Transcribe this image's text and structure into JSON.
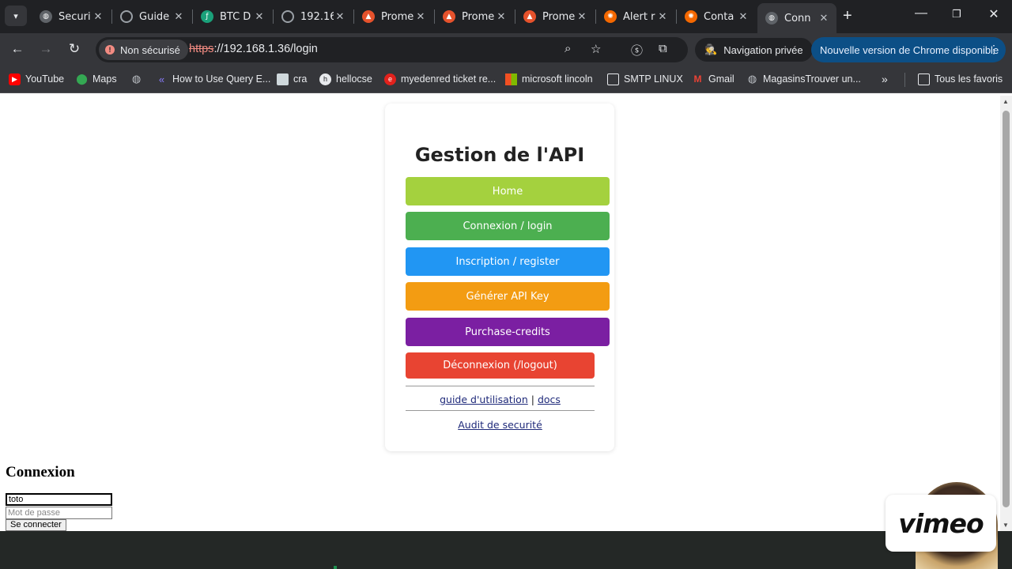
{
  "tabs": [
    {
      "label": "Securi",
      "favicon": "globe-icon",
      "color": "#9aa0a6"
    },
    {
      "label": "Guide",
      "favicon": "loading-icon",
      "color": "#9aa0a6"
    },
    {
      "label": "BTC D",
      "favicon": "feather-icon",
      "color": "#1aa17a"
    },
    {
      "label": "192.16",
      "favicon": "loading-icon",
      "color": "#9aa0a6"
    },
    {
      "label": "Prome",
      "favicon": "prometheus-icon",
      "color": "#e6522c"
    },
    {
      "label": "Prome",
      "favicon": "prometheus-icon",
      "color": "#e6522c"
    },
    {
      "label": "Prome",
      "favicon": "prometheus-icon",
      "color": "#e6522c"
    },
    {
      "label": "Alert r",
      "favicon": "grafana-icon",
      "color": "#f46800"
    },
    {
      "label": "Conta",
      "favicon": "grafana-icon",
      "color": "#f46800"
    },
    {
      "label": "Conn",
      "favicon": "globe-icon",
      "color": "#9aa0a6",
      "active": true
    }
  ],
  "toolbar": {
    "security_chip": "Non sécurisé",
    "url_scheme": "https",
    "url_rest": "://192.168.1.36/login",
    "incognito_label": "Navigation privée",
    "update_label": "Nouvelle version de Chrome disponible"
  },
  "bookmarks": [
    {
      "label": "YouTube",
      "icon": "youtube-icon",
      "color": "#ff0000"
    },
    {
      "label": "Maps",
      "icon": "maps-icon",
      "color": "#34a853"
    },
    {
      "label": "",
      "icon": "globe-icon",
      "color": "#9aa0a6"
    },
    {
      "label": "How to Use Query E...",
      "icon": "query-icon",
      "color": "#6c63ff"
    },
    {
      "label": "cra",
      "icon": "doc-icon",
      "color": "#cfd8dc"
    },
    {
      "label": "hellocse",
      "icon": "hellocse-icon",
      "color": "#e8eaed"
    },
    {
      "label": "myedenred ticket re...",
      "icon": "edenred-icon",
      "color": "#e2211c"
    },
    {
      "label": "microsoft lincoln",
      "icon": "microsoft-icon",
      "color": "#f25022"
    },
    {
      "label": "SMTP LINUX",
      "icon": "folder-icon",
      "color": "#35363a"
    },
    {
      "label": "Gmail",
      "icon": "gmail-icon",
      "color": "#ea4335"
    },
    {
      "label": "MagasinsTrouver un...",
      "icon": "globe-icon",
      "color": "#9aa0a6"
    }
  ],
  "bookmarks_all": "Tous les favoris",
  "card": {
    "title": "Gestion de l'API",
    "buttons": [
      {
        "label": "Home",
        "color": "#a4d13e"
      },
      {
        "label": "Connexion / login",
        "color": "#4caf50"
      },
      {
        "label": "Inscription / register",
        "color": "#2196f3"
      },
      {
        "label": "Générer API Key",
        "color": "#f39c12"
      },
      {
        "label": "Purchase-credits",
        "color": "#7b1fa2"
      },
      {
        "label": "Déconnexion (/logout)",
        "color": "#e84432"
      }
    ],
    "link_guide": "guide d'utilisation",
    "link_sep": " | ",
    "link_docs": "docs",
    "link_audit": "Audit de securité"
  },
  "login": {
    "heading": "Connexion",
    "username_value": "toto",
    "password_placeholder": "Mot de passe",
    "submit_label": "Se connecter"
  },
  "overlay": {
    "vimeo_label": "vimeo"
  }
}
